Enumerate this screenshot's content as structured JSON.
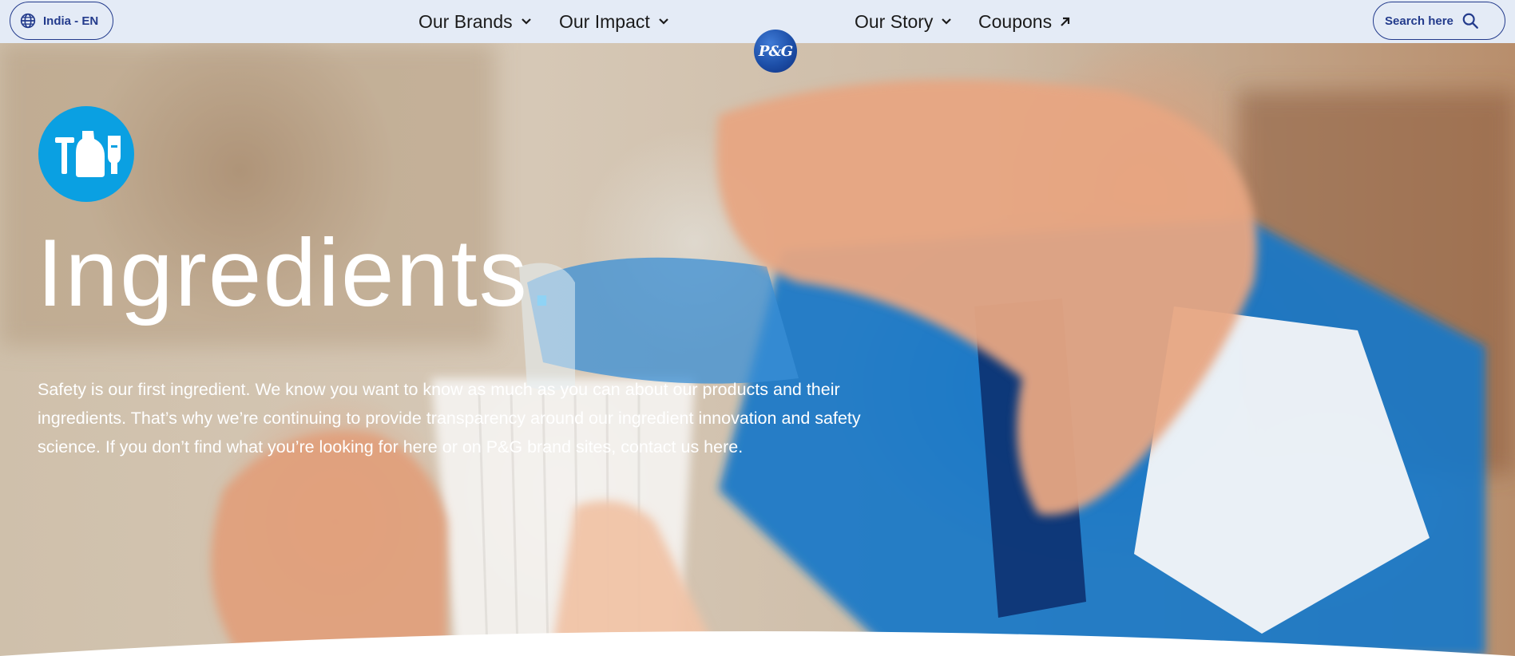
{
  "header": {
    "locale_label": "India - EN",
    "nav_left": [
      {
        "label": "Our Brands"
      },
      {
        "label": "Our Impact"
      }
    ],
    "nav_right": [
      {
        "label": "Our Story"
      },
      {
        "label": "Coupons"
      }
    ],
    "logo_text": "P&G",
    "search_label": "Search here"
  },
  "hero": {
    "title": "Ingredients",
    "title_dot": ".",
    "description": "Safety is our first ingredient. We know you want to know as much as you can about our products and their ingredients. That’s why we’re continuing to provide transparency around our ingredient innovation and safety science. If you don’t find what you’re looking for here or on P&G brand sites, contact us here.",
    "badge_icon": "household-products-icon"
  },
  "colors": {
    "nav_background": "#e4ebf6",
    "accent_navy": "#233b8c",
    "badge_blue": "#0aa0e2"
  }
}
